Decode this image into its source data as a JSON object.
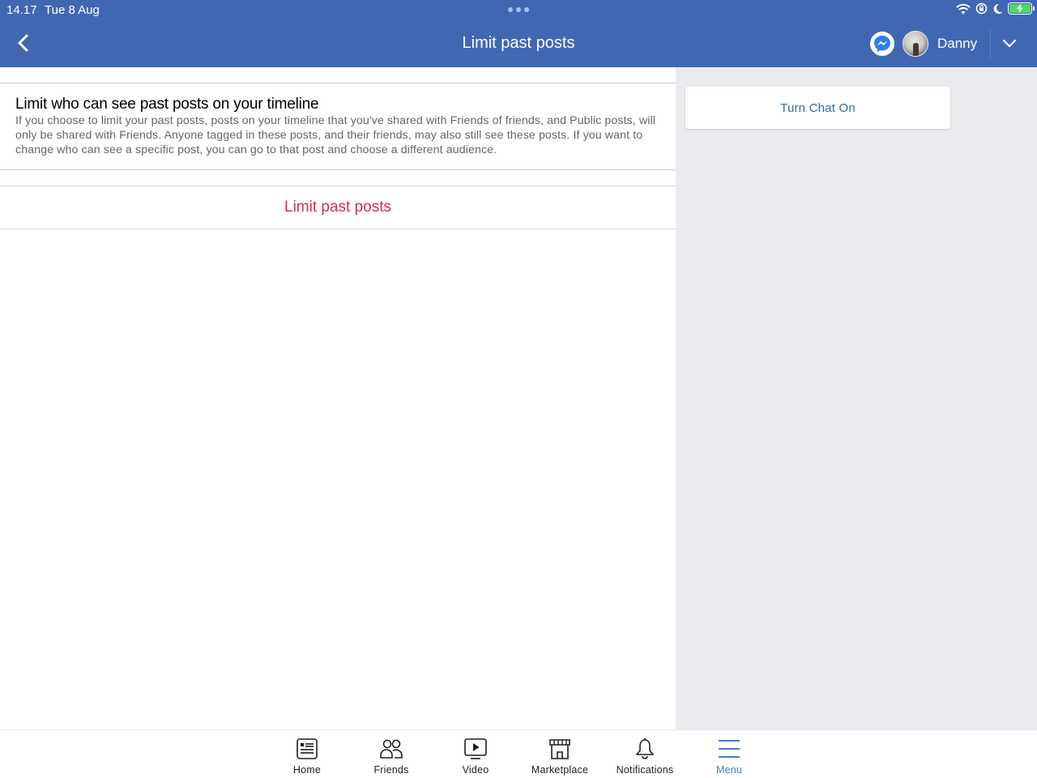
{
  "status_bar": {
    "time": "14.17",
    "date": "Tue 8 Aug",
    "icons": [
      "wifi-icon",
      "rotation-lock-icon",
      "do-not-disturb-moon-icon",
      "battery-charging-icon"
    ]
  },
  "nav": {
    "title": "Limit past posts",
    "back_icon": "chevron-left-icon",
    "messenger_icon": "messenger-icon",
    "profile_name": "Danny",
    "dropdown_icon": "chevron-down-icon"
  },
  "main": {
    "section_title": "Limit who can see past posts on your timeline",
    "section_description": "If you choose to limit your past posts, posts on your timeline that you've shared with Friends of friends, and Public posts, will only be shared with Friends. Anyone tagged in these posts, and their friends, may also still see these posts. If you want to change who can see a specific post, you can go to that post and choose a different audience.",
    "action_label": "Limit past posts"
  },
  "right_panel": {
    "chat_button_label": "Turn Chat On"
  },
  "tabbar": {
    "tabs": [
      {
        "label": "Home",
        "icon": "news-feed-icon",
        "active": false
      },
      {
        "label": "Friends",
        "icon": "friends-icon",
        "active": false
      },
      {
        "label": "Video",
        "icon": "video-play-icon",
        "active": false
      },
      {
        "label": "Marketplace",
        "icon": "storefront-icon",
        "active": false
      },
      {
        "label": "Notifications",
        "icon": "bell-icon",
        "active": false
      },
      {
        "label": "Menu",
        "icon": "hamburger-menu-icon",
        "active": true
      }
    ]
  },
  "colors": {
    "header_blue": "#4267b2",
    "action_red": "#dd2a4c",
    "link_blue": "#2d6fa3",
    "active_tab_blue": "#4a78c8",
    "panel_gray": "#e9ebee"
  }
}
